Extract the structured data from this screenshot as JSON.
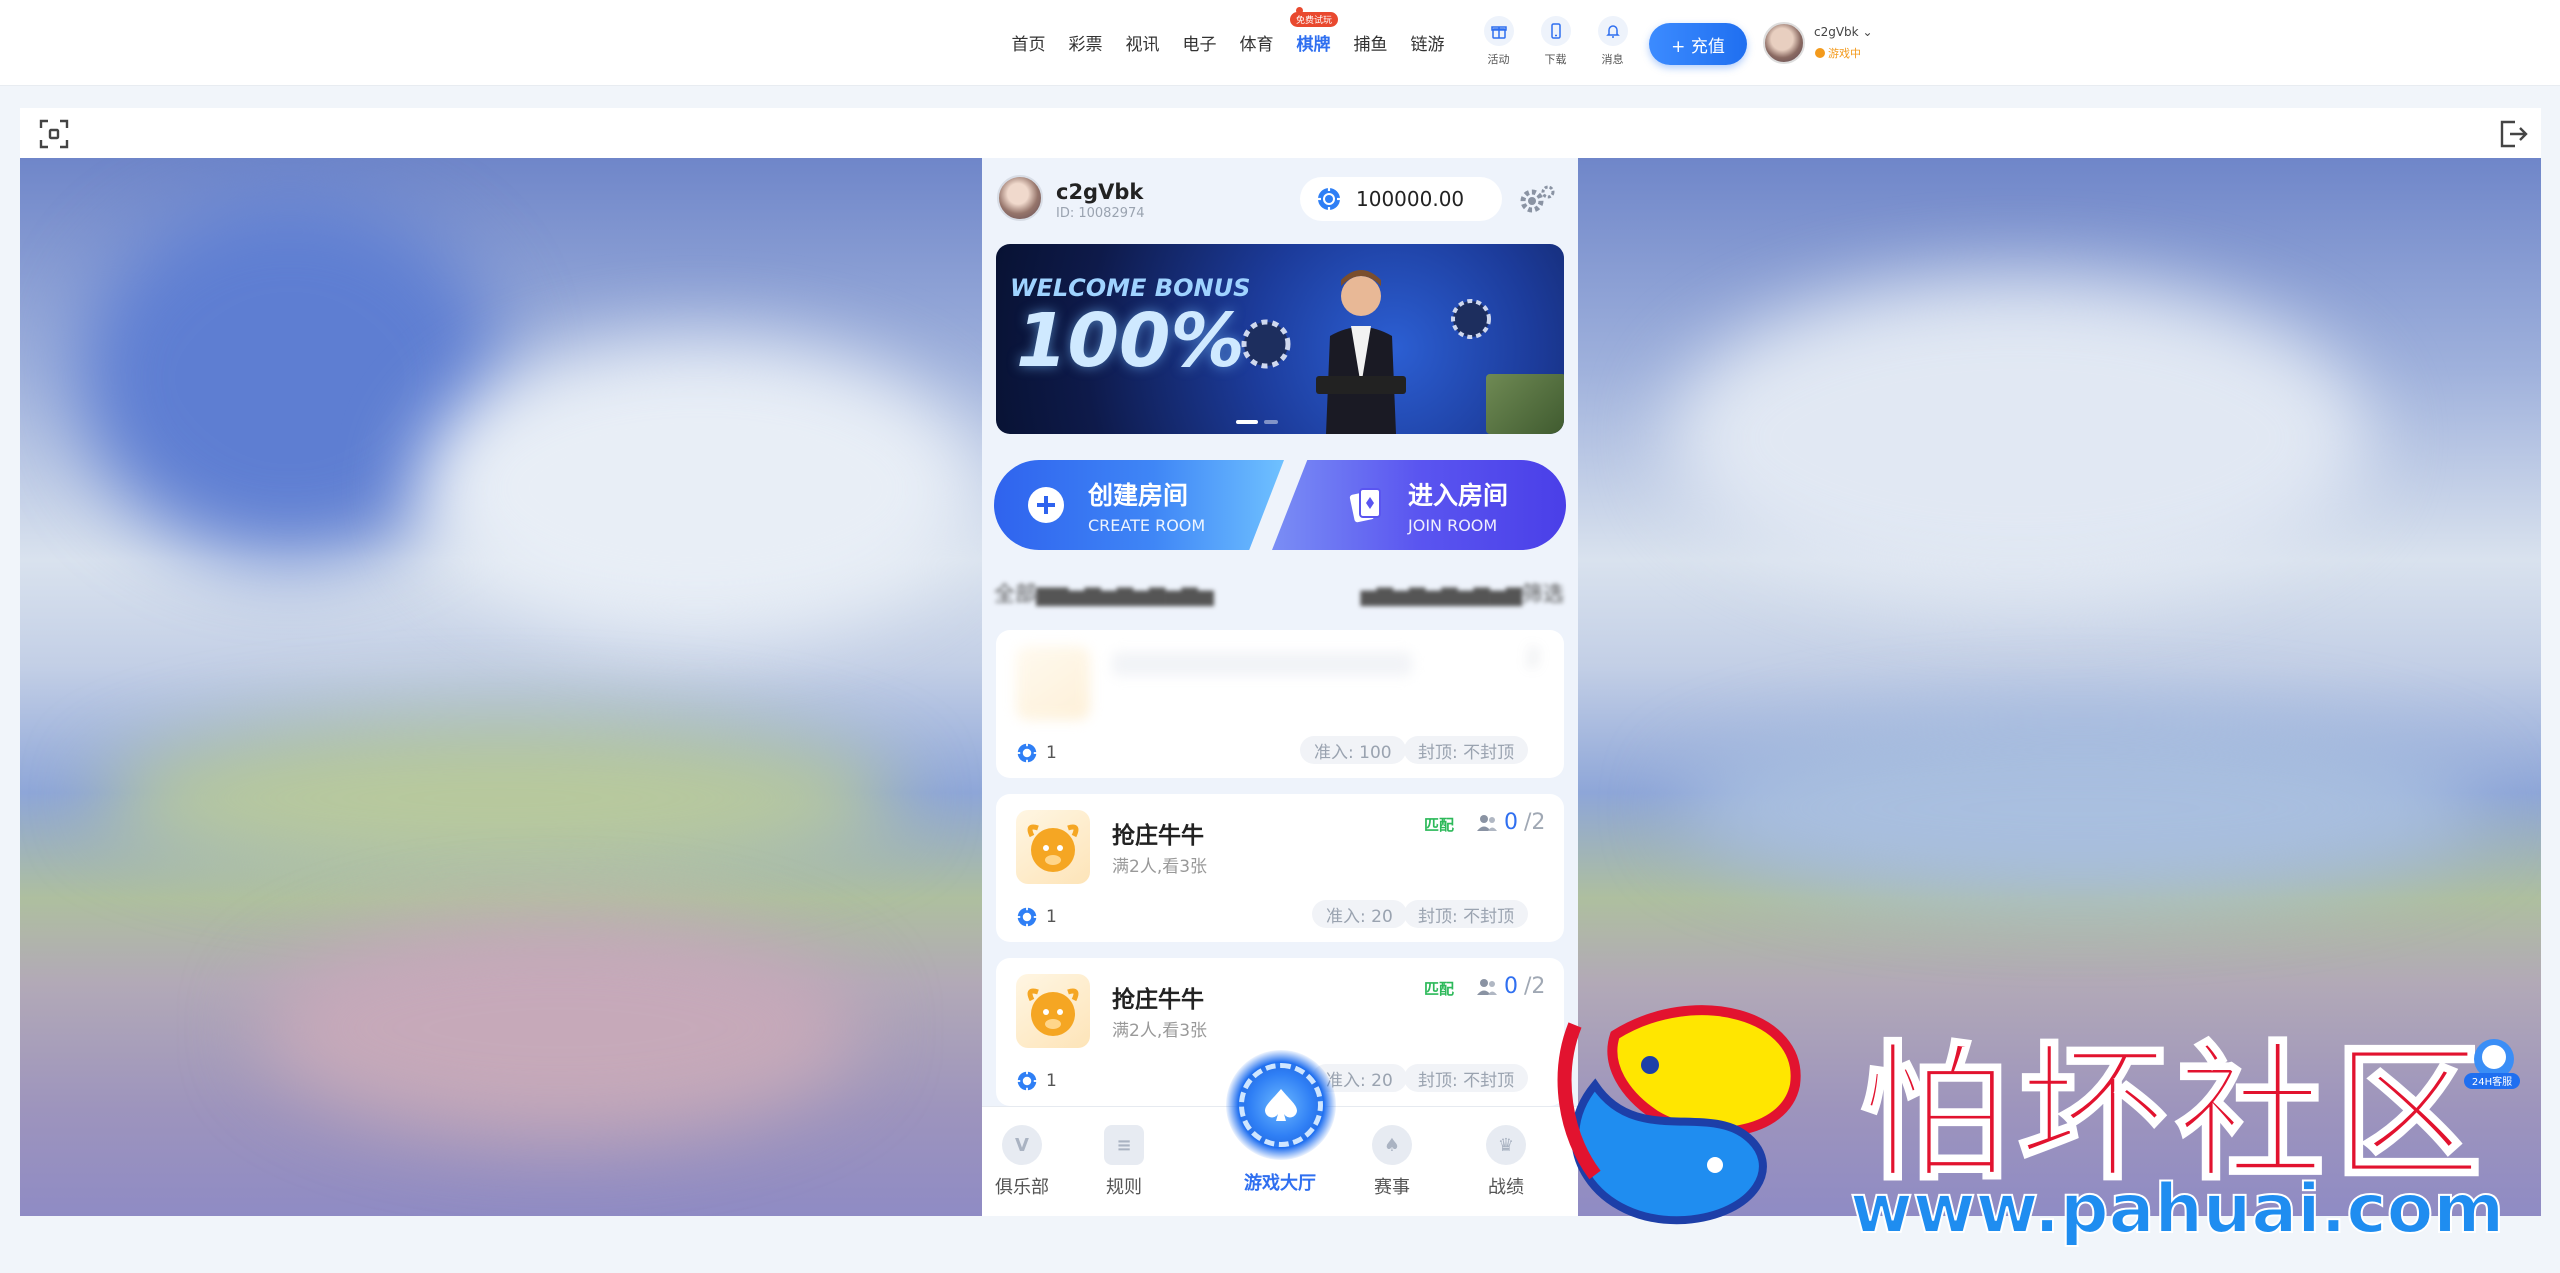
{
  "nav": {
    "items": [
      "首页",
      "彩票",
      "视讯",
      "电子",
      "体育",
      "棋牌",
      "捕鱼",
      "链游"
    ],
    "active_index": 5,
    "free_badge": "免费试玩",
    "icons": [
      {
        "label": "活动",
        "icon": "gift-icon"
      },
      {
        "label": "下载",
        "icon": "phone-icon"
      },
      {
        "label": "消息",
        "icon": "bell-icon"
      }
    ],
    "recharge_label": "+ 充值",
    "username": "c2gVbk",
    "status": "游戏中"
  },
  "toolbar": {
    "fullscreen_icon": "fullscreen-icon",
    "exit_icon": "exit-icon"
  },
  "app": {
    "username": "c2gVbk",
    "user_id": "ID: 10082974",
    "balance": "100000.00",
    "banner": {
      "line1": "WELCOME BONUS",
      "line2": "100%"
    },
    "create_room": {
      "title": "创建房间",
      "subtitle": "CREATE ROOM"
    },
    "join_room": {
      "title": "进入房间",
      "subtitle": "JOIN ROOM"
    },
    "filter_left": "全部",
    "filter_right": "筛选",
    "rooms": [
      {
        "name": "",
        "desc": "",
        "match": "",
        "seats_current": "",
        "seats_max": "2",
        "chip": "1",
        "entry": "准入: 100",
        "cap": "封顶: 不封顶",
        "blurred": true
      },
      {
        "name": "抢庄牛牛",
        "desc": "满2人,看3张",
        "match": "匹配",
        "seats_current": "0",
        "seats_max": "/2",
        "chip": "1",
        "entry": "准入: 20",
        "cap": "封顶: 不封顶",
        "blurred": false
      },
      {
        "name": "抢庄牛牛",
        "desc": "满2人,看3张",
        "match": "匹配",
        "seats_current": "0",
        "seats_max": "/2",
        "chip": "1",
        "entry": "准入: 20",
        "cap": "封顶: 不封顶",
        "blurred": false
      }
    ],
    "bottom_nav": [
      "俱乐部",
      "规则",
      "游戏大厅",
      "赛事",
      "战绩"
    ],
    "bottom_active": 2
  },
  "watermark": {
    "title": "怕坏社区",
    "url": "www.pahuai.com",
    "support_label": "24H客服"
  },
  "colors": {
    "accent": "#2f6ff0",
    "match": "#2db95a",
    "watermark_red": "#e2132f",
    "watermark_blue": "#1f8df0"
  }
}
